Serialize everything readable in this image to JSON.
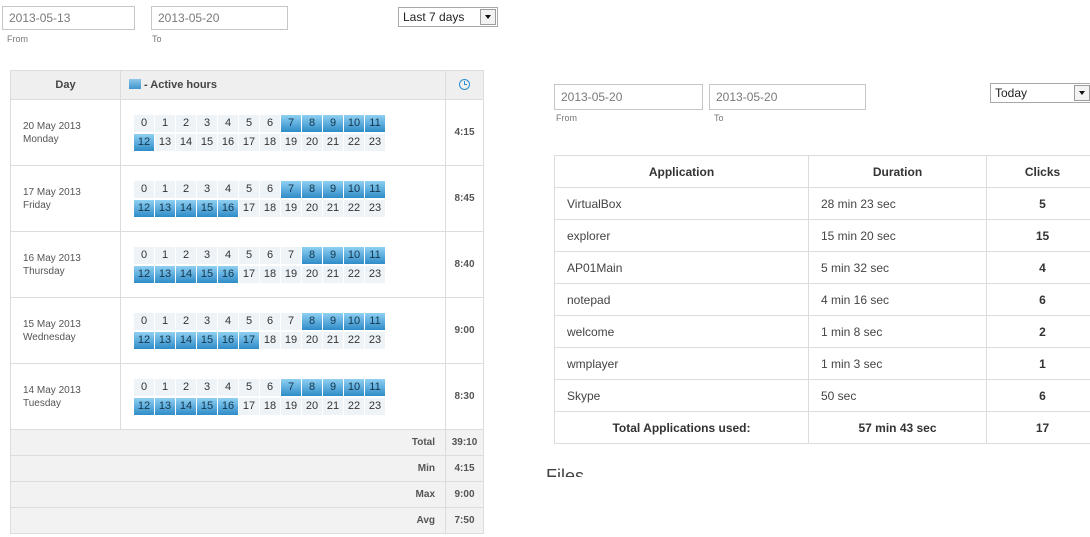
{
  "left": {
    "from_value": "2013-05-13",
    "to_value": "2013-05-20",
    "from_label": "From",
    "to_label": "To",
    "range": "Last 7 days",
    "headers": {
      "day": "Day",
      "hours": "- Active hours"
    },
    "days": [
      {
        "date": "20 May 2013",
        "weekday": "Monday",
        "duration": "4:15",
        "active": [
          7,
          8,
          9,
          10,
          11,
          12
        ]
      },
      {
        "date": "17 May 2013",
        "weekday": "Friday",
        "duration": "8:45",
        "active": [
          7,
          8,
          9,
          10,
          11,
          12,
          13,
          14,
          15,
          16
        ]
      },
      {
        "date": "16 May 2013",
        "weekday": "Thursday",
        "duration": "8:40",
        "active": [
          8,
          9,
          10,
          11,
          12,
          13,
          14,
          15,
          16
        ]
      },
      {
        "date": "15 May 2013",
        "weekday": "Wednesday",
        "duration": "9:00",
        "active": [
          8,
          9,
          10,
          11,
          12,
          13,
          14,
          15,
          16,
          17
        ]
      },
      {
        "date": "14 May 2013",
        "weekday": "Tuesday",
        "duration": "8:30",
        "active": [
          7,
          8,
          9,
          10,
          11,
          12,
          13,
          14,
          15,
          16
        ]
      }
    ],
    "summary": [
      {
        "label": "Total",
        "value": "39:10"
      },
      {
        "label": "Min",
        "value": "4:15"
      },
      {
        "label": "Max",
        "value": "9:00"
      },
      {
        "label": "Avg",
        "value": "7:50"
      }
    ],
    "colors": {
      "active": "#2f8cc8",
      "inactive": "#eef3f8"
    }
  },
  "right": {
    "from_value": "2013-05-20",
    "to_value": "2013-05-20",
    "from_label": "From",
    "to_label": "To",
    "range": "Today",
    "headers": {
      "application": "Application",
      "duration": "Duration",
      "clicks": "Clicks"
    },
    "apps": [
      {
        "name": "VirtualBox",
        "duration": "28 min 23 sec",
        "clicks": "5"
      },
      {
        "name": "explorer",
        "duration": "15 min 20 sec",
        "clicks": "15"
      },
      {
        "name": "AP01Main",
        "duration": "5 min 32 sec",
        "clicks": "4"
      },
      {
        "name": "notepad",
        "duration": "4 min 16 sec",
        "clicks": "6"
      },
      {
        "name": "welcome",
        "duration": "1 min 8 sec",
        "clicks": "2"
      },
      {
        "name": "wmplayer",
        "duration": "1 min 3 sec",
        "clicks": "1"
      },
      {
        "name": "Skype",
        "duration": "50 sec",
        "clicks": "6"
      }
    ],
    "total": {
      "label": "Total Applications used:",
      "duration": "57 min 43 sec",
      "clicks": "17"
    },
    "files_heading": "Files"
  }
}
